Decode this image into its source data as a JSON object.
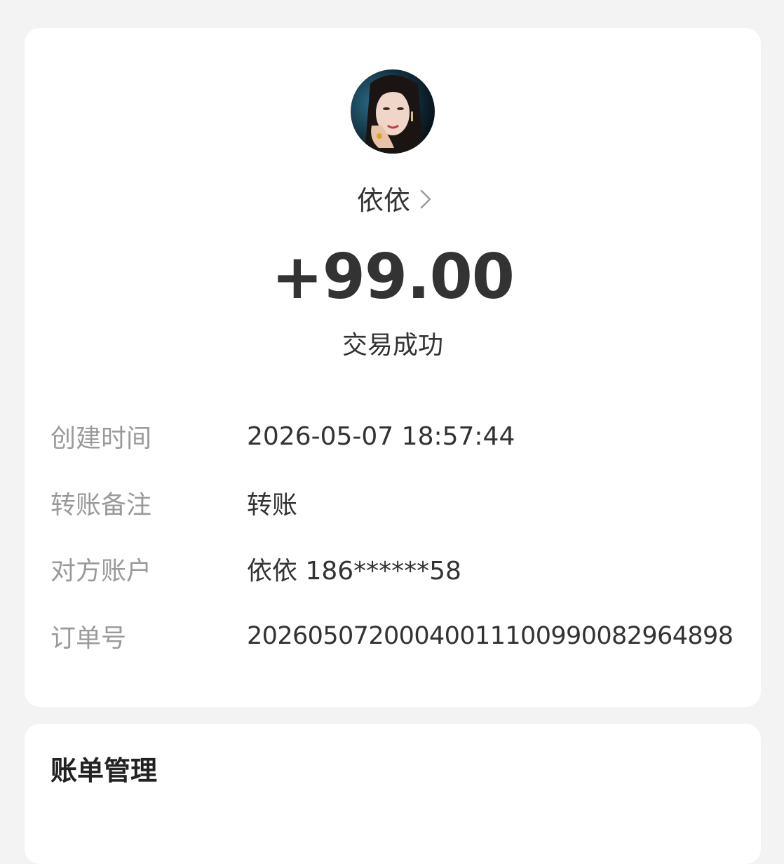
{
  "payee": {
    "name": "依依"
  },
  "transaction": {
    "amount": "+99.00",
    "status": "交易成功"
  },
  "details": [
    {
      "label": "创建时间",
      "value": "2026-05-07 18:57:44"
    },
    {
      "label": "转账备注",
      "value": "转账"
    },
    {
      "label": "对方账户",
      "value": "依依 186******58"
    },
    {
      "label": "订单号",
      "value": "20260507200040011100990082964898"
    }
  ],
  "bill_section": {
    "title": "账单管理"
  },
  "icons": {
    "payee_chevron": "chevron-right-icon"
  },
  "colors": {
    "background": "#f3f3f3",
    "card": "#ffffff",
    "primary_text": "#333333",
    "secondary_text": "#9a9a9a"
  }
}
